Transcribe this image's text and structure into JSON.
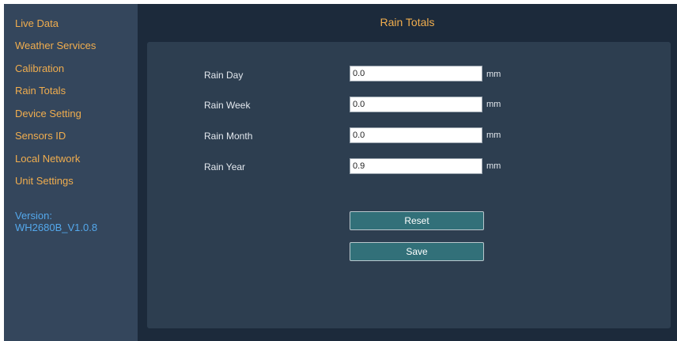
{
  "sidebar": {
    "items": [
      {
        "label": "Live Data"
      },
      {
        "label": "Weather Services"
      },
      {
        "label": "Calibration"
      },
      {
        "label": "Rain Totals"
      },
      {
        "label": "Device Setting"
      },
      {
        "label": "Sensors ID"
      },
      {
        "label": "Local Network"
      },
      {
        "label": "Unit Settings"
      }
    ],
    "version_label": "Version:",
    "version_value": "WH2680B_V1.0.8"
  },
  "main": {
    "title": "Rain Totals",
    "fields": [
      {
        "label": "Rain Day",
        "value": "0.0",
        "unit": "mm"
      },
      {
        "label": "Rain Week",
        "value": "0.0",
        "unit": "mm"
      },
      {
        "label": "Rain Month",
        "value": "0.0",
        "unit": "mm"
      },
      {
        "label": "Rain Year",
        "value": "0.9",
        "unit": "mm"
      }
    ],
    "reset_label": "Reset",
    "save_label": "Save"
  },
  "colors": {
    "background": "#1c2a3b",
    "sidebar": "#34465c",
    "panel": "#2d3e50",
    "accent": "#f0ad4e",
    "version": "#54a8ec",
    "button": "#327079"
  }
}
